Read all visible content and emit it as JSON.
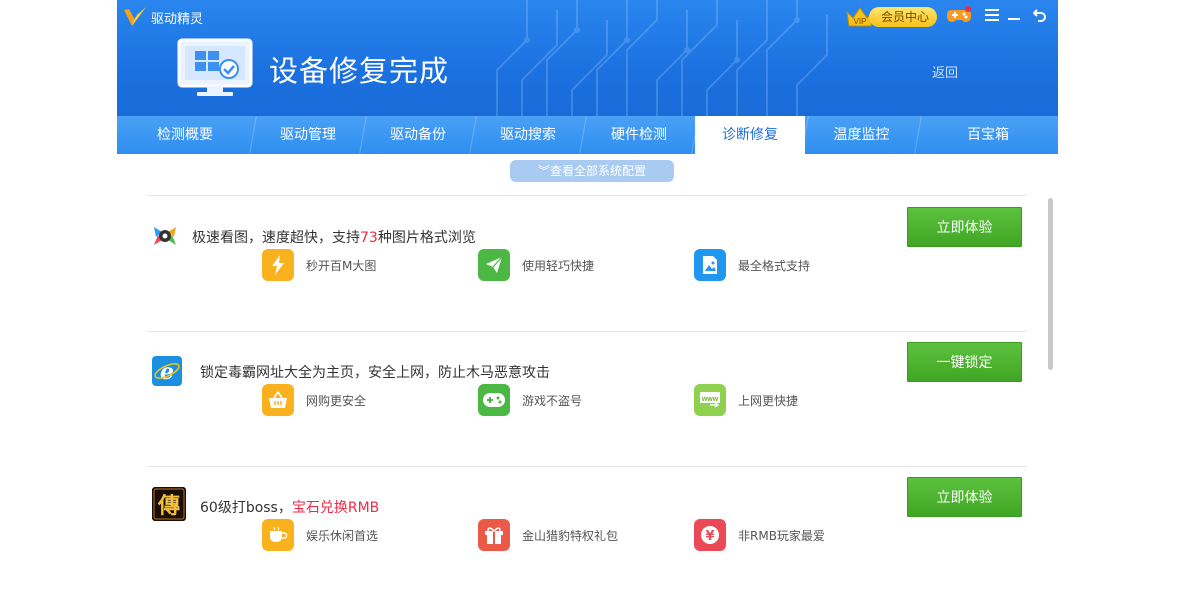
{
  "app": {
    "name": "驱动精灵"
  },
  "header": {
    "title": "设备修复完成",
    "back": "返回",
    "vip_label": "会员中心"
  },
  "tabs": [
    {
      "label": "检测概要",
      "active": false
    },
    {
      "label": "驱动管理",
      "active": false
    },
    {
      "label": "驱动备份",
      "active": false
    },
    {
      "label": "驱动搜索",
      "active": false
    },
    {
      "label": "硬件检测",
      "active": false
    },
    {
      "label": "诊断修复",
      "active": true
    },
    {
      "label": "温度监控",
      "active": false
    },
    {
      "label": "百宝箱",
      "active": false
    }
  ],
  "view_all": "查看全部系统配置",
  "sections": [
    {
      "title_pre": "极速看图，速度超快，支持",
      "title_hl": "73",
      "title_post": "种图片格式浏览",
      "button": "立即体验",
      "icon": "photo-viewer-eye-icon",
      "features": [
        {
          "label": "秒开百M大图",
          "icon": "lightning-icon",
          "color": "#f9b21d"
        },
        {
          "label": "使用轻巧快捷",
          "icon": "paper-plane-icon",
          "color": "#4bb844"
        },
        {
          "label": "最全格式支持",
          "icon": "image-file-icon",
          "color": "#2196f0"
        }
      ]
    },
    {
      "title_pre": "锁定毒霸网址大全为主页，安全上网，防止木马恶意攻击",
      "title_hl": "",
      "title_post": "",
      "button": "一键锁定",
      "icon": "ie-browser-icon",
      "features": [
        {
          "label": "网购更安全",
          "icon": "shopping-basket-icon",
          "color": "#f9b21d"
        },
        {
          "label": "游戏不盗号",
          "icon": "gamepad-icon",
          "color": "#4bb844"
        },
        {
          "label": "上网更快捷",
          "icon": "www-icon",
          "color": "#8fd14f"
        }
      ]
    },
    {
      "title_pre": "60级打boss，",
      "title_hl": "宝石兑换RMB",
      "title_post": "",
      "button": "立即体验",
      "icon": "legend-game-icon",
      "features": [
        {
          "label": "娱乐休闲首选",
          "icon": "coffee-cup-icon",
          "color": "#f9b21d"
        },
        {
          "label": "金山猎豹特权礼包",
          "icon": "gift-icon",
          "color": "#ea5a47"
        },
        {
          "label": "非RMB玩家最爱",
          "icon": "yen-icon",
          "color": "#ea4a55"
        }
      ]
    }
  ]
}
